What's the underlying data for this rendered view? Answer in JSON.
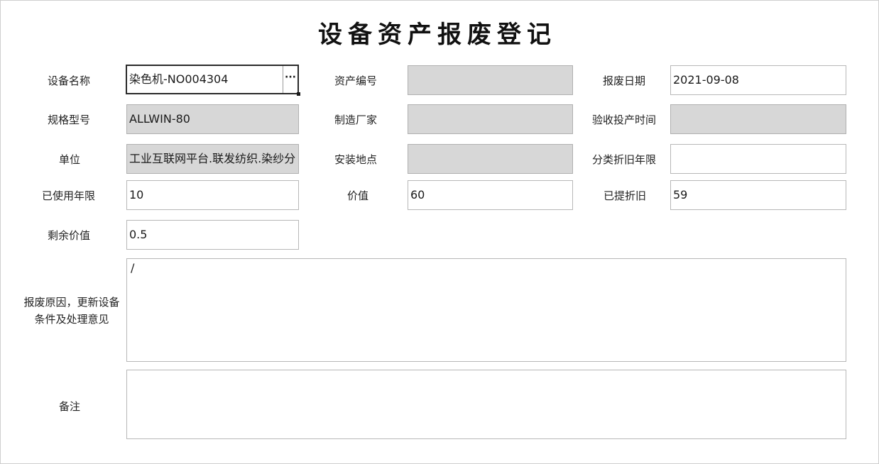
{
  "form": {
    "title": "设备资产报废登记",
    "fields": {
      "equipment_name": {
        "label": "设备名称",
        "value": "染色机-NO004304",
        "lookup_glyph": "···"
      },
      "asset_number": {
        "label": "资产编号",
        "value": ""
      },
      "scrap_date": {
        "label": "报废日期",
        "value": "2021-09-08"
      },
      "model_spec": {
        "label": "规格型号",
        "value": "ALLWIN-80"
      },
      "manufacturer": {
        "label": "制造厂家",
        "value": ""
      },
      "acceptance_time": {
        "label": "验收投产时间",
        "value": ""
      },
      "unit": {
        "label": "单位",
        "value": "工业互联网平台.联发纺织.染纱分"
      },
      "install_location": {
        "label": "安装地点",
        "value": ""
      },
      "depreciation_years": {
        "label": "分类折旧年限",
        "value": ""
      },
      "used_years": {
        "label": "已使用年限",
        "value": "10"
      },
      "value": {
        "label": "价值",
        "value": "60"
      },
      "depreciated": {
        "label": "已提折旧",
        "value": "59"
      },
      "residual_value": {
        "label": "剩余价值",
        "value": "0.5"
      },
      "scrap_reason": {
        "label": "报废原因，更新设备条件及处理意见",
        "value": "/"
      },
      "remarks": {
        "label": "备注",
        "value": ""
      }
    }
  },
  "colors": {
    "disabled_bg": "#d7d7d7",
    "border": "#b7b7b7",
    "focus_border": "#2a2a2a"
  }
}
